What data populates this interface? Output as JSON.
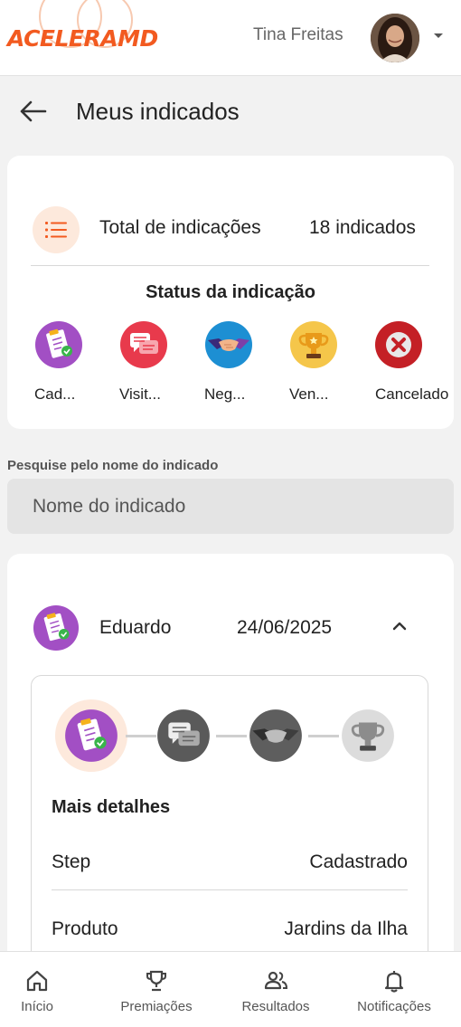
{
  "header": {
    "logo_text": "ACELERAMD",
    "user_name": "Tina Freitas"
  },
  "page": {
    "title": "Meus indicados"
  },
  "summary": {
    "total_label": "Total de indicações",
    "total_value": "18 indicados",
    "status_title": "Status da indicação",
    "statuses": [
      {
        "label": "Cad...",
        "icon": "clipboard-check-icon",
        "color": "#a24fc4"
      },
      {
        "label": "Visit...",
        "icon": "chat-bubbles-icon",
        "color": "#e83a4c"
      },
      {
        "label": "Neg...",
        "icon": "handshake-icon",
        "color": "#1d8fd3"
      },
      {
        "label": "Ven...",
        "icon": "trophy-icon",
        "color": "#f5b21c"
      },
      {
        "label": "Cancelado",
        "icon": "cancel-x-icon",
        "color": "#c42026"
      }
    ]
  },
  "search": {
    "label": "Pesquise pelo nome do indicado",
    "placeholder": "Nome do indicado",
    "value": ""
  },
  "lead": {
    "name": "Eduardo",
    "date": "24/06/2025",
    "details_title": "Mais detalhes",
    "details": [
      {
        "key": "Step",
        "value": "Cadastrado"
      },
      {
        "key": "Produto",
        "value": "Jardins da Ilha"
      }
    ]
  },
  "nav": {
    "items": [
      {
        "label": "Início",
        "icon": "home-icon"
      },
      {
        "label": "Premiações",
        "icon": "trophy-outline-icon"
      },
      {
        "label": "Resultados",
        "icon": "people-icon"
      },
      {
        "label": "Notificações",
        "icon": "bell-icon"
      }
    ]
  },
  "colors": {
    "accent": "#f25a20",
    "accent_soft": "#fde9dc",
    "card_bg": "#ffffff",
    "page_bg": "#f2f2f2"
  }
}
